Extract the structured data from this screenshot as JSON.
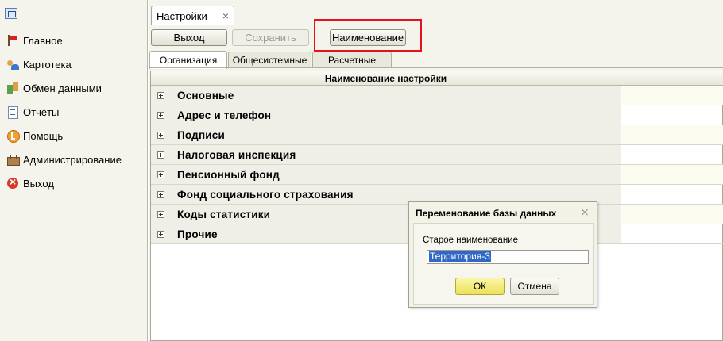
{
  "sidebar": {
    "items": [
      {
        "label": "Главное",
        "icon": "flag-icon"
      },
      {
        "label": "Картотека",
        "icon": "people-icon"
      },
      {
        "label": "Обмен данными",
        "icon": "exchange-icon"
      },
      {
        "label": "Отчёты",
        "icon": "report-icon"
      },
      {
        "label": "Помощь",
        "icon": "help-icon"
      },
      {
        "label": "Администрирование",
        "icon": "toolbox-icon"
      },
      {
        "label": "Выход",
        "icon": "exit-icon"
      }
    ]
  },
  "document_tab": {
    "label": "Настройки",
    "close_glyph": "×"
  },
  "toolbar": {
    "exit_label": "Выход",
    "save_label": "Сохранить",
    "rename_label": "Наименование"
  },
  "sub_tabs": [
    "Организация",
    "Общесистемные",
    "Расчетные"
  ],
  "table": {
    "header": "Наименование настройки",
    "rows": [
      "Основные",
      "Адрес и телефон",
      "Подписи",
      "Налоговая инспекция",
      "Пенсионный фонд",
      "Фонд социального страхования",
      "Коды статистики",
      "Прочие"
    ]
  },
  "dialog": {
    "title": "Переменование базы данных",
    "field_label": "Старое наименование",
    "field_value": "Территория-3",
    "ok_label": "ОК",
    "cancel_label": "Отмена"
  },
  "colors": {
    "highlight": "#e8101a",
    "ok_button": "#ece05a",
    "selection": "#3168c8"
  }
}
